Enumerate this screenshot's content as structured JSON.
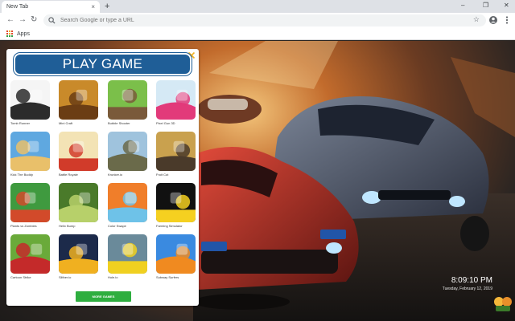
{
  "browser": {
    "tab_title": "New Tab",
    "tab_close": "×",
    "new_tab": "+",
    "window_controls": {
      "minimize": "–",
      "maximize": "❐",
      "close": "✕"
    },
    "nav": {
      "back": "←",
      "forward": "→",
      "reload": "↻"
    },
    "omnibox_placeholder": "Search Google or type a URL",
    "bookmark_star": "☆",
    "bookmarks_apps": "Apps"
  },
  "panel": {
    "title": "PLAY GAME",
    "more_button": "MORE GAMES",
    "games": [
      {
        "name": "Tomb Runner",
        "colors": [
          "#f5f5f5",
          "#2b2b2b"
        ]
      },
      {
        "name": "Mini Craft",
        "colors": [
          "#c98a2a",
          "#6b3d14"
        ]
      },
      {
        "name": "Bubble Shooter",
        "colors": [
          "#7bbf4a",
          "#7a5a3a"
        ]
      },
      {
        "name": "Pixel Gun 3D",
        "colors": [
          "#d5e9f5",
          "#e23a7a"
        ]
      },
      {
        "name": "Kick The Buddy",
        "colors": [
          "#5fa8e0",
          "#e9c06a"
        ]
      },
      {
        "name": "Battle Royale",
        "colors": [
          "#f3e3b5",
          "#d13b2a"
        ]
      },
      {
        "name": "Krunker.io",
        "colors": [
          "#9fc3dd",
          "#6a6a4a"
        ]
      },
      {
        "name": "Fruit Cut",
        "colors": [
          "#c9a14e",
          "#4a3a2a"
        ]
      },
      {
        "name": "Plants vs Zombies",
        "colors": [
          "#3f9a3f",
          "#d24a2a"
        ]
      },
      {
        "name": "Helix Bump",
        "colors": [
          "#4a7a2a",
          "#b7d06a"
        ]
      },
      {
        "name": "Color Swape",
        "colors": [
          "#f07e2a",
          "#6ec2e8"
        ]
      },
      {
        "name": "Farming Simulator",
        "colors": [
          "#111111",
          "#f5d020"
        ]
      },
      {
        "name": "Cartoon Strike",
        "colors": [
          "#6aaa3a",
          "#c42a2a"
        ]
      },
      {
        "name": "Slither.io",
        "colors": [
          "#1c2a4a",
          "#f0b020"
        ]
      },
      {
        "name": "Hole.io",
        "colors": [
          "#6a8a9a",
          "#f0d020"
        ]
      },
      {
        "name": "Subway Surfers",
        "colors": [
          "#3a8ae0",
          "#f08a20"
        ]
      }
    ]
  },
  "clock": {
    "time": "8:09:10 PM",
    "date": "Tuesday, February 12, 2019"
  },
  "colors": {
    "play_button": "#1f5e97",
    "more_button": "#2eae3f",
    "tab_strip": "#dee1e6"
  }
}
